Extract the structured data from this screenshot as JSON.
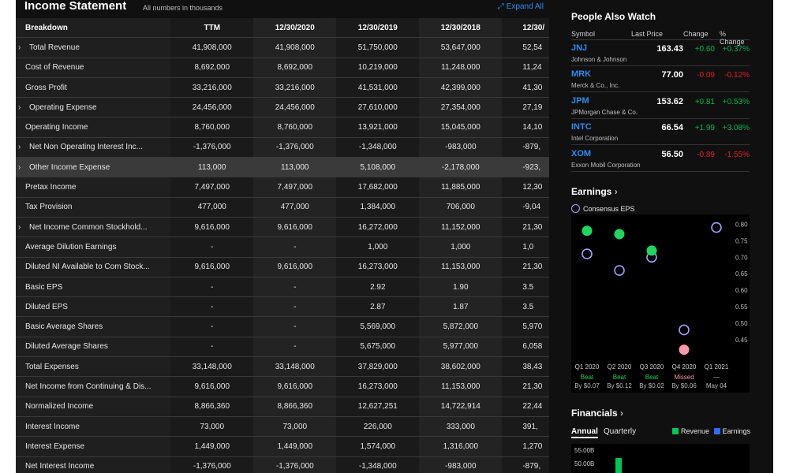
{
  "income_statement": {
    "title": "Income Statement",
    "subtitle": "All numbers in thousands",
    "expand_label": "Expand All",
    "columns": [
      "Breakdown",
      "TTM",
      "12/30/2020",
      "12/30/2019",
      "12/30/2018",
      "12/30/"
    ],
    "rows": [
      {
        "label": "Total Revenue",
        "expandable": true,
        "values": [
          "41,908,000",
          "41,908,000",
          "51,750,000",
          "53,647,000",
          "52,54"
        ]
      },
      {
        "label": "Cost of Revenue",
        "expandable": false,
        "values": [
          "8,692,000",
          "8,692,000",
          "10,219,000",
          "11,248,000",
          "11,24"
        ]
      },
      {
        "label": "Gross Profit",
        "expandable": false,
        "values": [
          "33,216,000",
          "33,216,000",
          "41,531,000",
          "42,399,000",
          "41,30"
        ]
      },
      {
        "label": "Operating Expense",
        "expandable": true,
        "values": [
          "24,456,000",
          "24,456,000",
          "27,610,000",
          "27,354,000",
          "27,19"
        ]
      },
      {
        "label": "Operating Income",
        "expandable": false,
        "values": [
          "8,760,000",
          "8,760,000",
          "13,921,000",
          "15,045,000",
          "14,10"
        ]
      },
      {
        "label": "Net Non Operating Interest Inc...",
        "expandable": true,
        "values": [
          "-1,376,000",
          "-1,376,000",
          "-1,348,000",
          "-983,000",
          "-879,"
        ]
      },
      {
        "label": "Other Income Expense",
        "expandable": true,
        "highlight": true,
        "values": [
          "113,000",
          "113,000",
          "5,108,000",
          "-2,178,000",
          "-923,"
        ]
      },
      {
        "label": "Pretax Income",
        "expandable": false,
        "values": [
          "7,497,000",
          "7,497,000",
          "17,682,000",
          "11,885,000",
          "12,30"
        ]
      },
      {
        "label": "Tax Provision",
        "expandable": false,
        "values": [
          "477,000",
          "477,000",
          "1,384,000",
          "706,000",
          "-9,04"
        ]
      },
      {
        "label": "Net Income Common Stockhold...",
        "expandable": true,
        "values": [
          "9,616,000",
          "9,616,000",
          "16,272,000",
          "11,152,000",
          "21,30"
        ]
      },
      {
        "label": "Average Dilution Earnings",
        "expandable": false,
        "values": [
          "-",
          "-",
          "1,000",
          "1,000",
          "1,0"
        ]
      },
      {
        "label": "Diluted NI Available to Com Stock...",
        "expandable": false,
        "values": [
          "9,616,000",
          "9,616,000",
          "16,273,000",
          "11,153,000",
          "21,30"
        ]
      },
      {
        "label": "Basic EPS",
        "expandable": false,
        "values": [
          "-",
          "-",
          "2.92",
          "1.90",
          "3.5"
        ]
      },
      {
        "label": "Diluted EPS",
        "expandable": false,
        "values": [
          "-",
          "-",
          "2.87",
          "1.87",
          "3.5"
        ]
      },
      {
        "label": "Basic Average Shares",
        "expandable": false,
        "values": [
          "-",
          "-",
          "5,569,000",
          "5,872,000",
          "5,970"
        ]
      },
      {
        "label": "Diluted Average Shares",
        "expandable": false,
        "values": [
          "-",
          "-",
          "5,675,000",
          "5,977,000",
          "6,058"
        ]
      },
      {
        "label": "Total Expenses",
        "expandable": false,
        "values": [
          "33,148,000",
          "33,148,000",
          "37,829,000",
          "38,602,000",
          "38,43"
        ]
      },
      {
        "label": "Net Income from Continuing & Dis...",
        "expandable": false,
        "values": [
          "9,616,000",
          "9,616,000",
          "16,273,000",
          "11,153,000",
          "21,30"
        ]
      },
      {
        "label": "Normalized Income",
        "expandable": false,
        "values": [
          "8,866,360",
          "8,866,360",
          "12,627,251",
          "14,722,914",
          "22,44"
        ]
      },
      {
        "label": "Interest Income",
        "expandable": false,
        "values": [
          "73,000",
          "73,000",
          "226,000",
          "333,000",
          "391,"
        ]
      },
      {
        "label": "Interest Expense",
        "expandable": false,
        "values": [
          "1,449,000",
          "1,449,000",
          "1,574,000",
          "1,316,000",
          "1,270"
        ]
      },
      {
        "label": "Net Interest Income",
        "expandable": false,
        "values": [
          "-1,376,000",
          "-1,376,000",
          "-1,348,000",
          "-983,000",
          "-879,"
        ]
      }
    ]
  },
  "people_also_watch": {
    "title": "People Also Watch",
    "columns": {
      "symbol": "Symbol",
      "last_price": "Last Price",
      "change": "Change",
      "pct_change": "% Change"
    },
    "items": [
      {
        "symbol": "JNJ",
        "name": "Johnson & Johnson",
        "price": "163.43",
        "change": "+0.60",
        "pct": "+0.37%",
        "dir": "up"
      },
      {
        "symbol": "MRK",
        "name": "Merck & Co., Inc.",
        "price": "77.00",
        "change": "-0.09",
        "pct": "-0.12%",
        "dir": "down"
      },
      {
        "symbol": "JPM",
        "name": "JPMorgan Chase & Co.",
        "price": "153.62",
        "change": "+0.81",
        "pct": "+0.53%",
        "dir": "up"
      },
      {
        "symbol": "INTC",
        "name": "Intel Corporation",
        "price": "66.54",
        "change": "+1.99",
        "pct": "+3.08%",
        "dir": "up"
      },
      {
        "symbol": "XOM",
        "name": "Exxon Mobil Corporation",
        "price": "56.50",
        "change": "-0.89",
        "pct": "-1.55%",
        "dir": "down"
      }
    ]
  },
  "earnings": {
    "title": "Earnings",
    "legend_label": "Consensus EPS"
  },
  "financials": {
    "title": "Financials",
    "tab_annual": "Annual",
    "tab_quarterly": "Quarterly",
    "legend_revenue": "Revenue",
    "legend_earnings": "Earnings",
    "axis_labels": [
      "55.00B",
      "50.00B"
    ],
    "revenue_color": "#00c853",
    "earnings_color": "#2f6bff"
  },
  "chart_data": {
    "type": "scatter",
    "title": "Earnings",
    "categories": [
      "Q1 2020",
      "Q2 2020",
      "Q3 2020",
      "Q4 2020",
      "Q1 2021"
    ],
    "category_sublabels": [
      "",
      "",
      "",
      "",
      ""
    ],
    "results": [
      "Beat",
      "Beat",
      "Beat",
      "Missed",
      "—"
    ],
    "result_details": [
      "By $0.07",
      "By $0.12",
      "By $0.02",
      "By $0.06",
      "May 04"
    ],
    "series": [
      {
        "name": "Consensus EPS",
        "values": [
          0.71,
          0.66,
          0.7,
          0.48,
          0.79
        ]
      },
      {
        "name": "",
        "values": [
          0.78,
          0.77,
          0.72,
          0.42,
          null
        ]
      }
    ],
    "y_ticks": [
      "0.80",
      "0.75",
      "0.70",
      "0.65",
      "0.60",
      "0.55",
      "0.50",
      "0.45"
    ],
    "ylim": [
      0.4,
      0.82
    ],
    "colors": {
      "beat": "#1ed760",
      "missed": "#f59aad",
      "consensus": "#9aa0ff"
    }
  }
}
